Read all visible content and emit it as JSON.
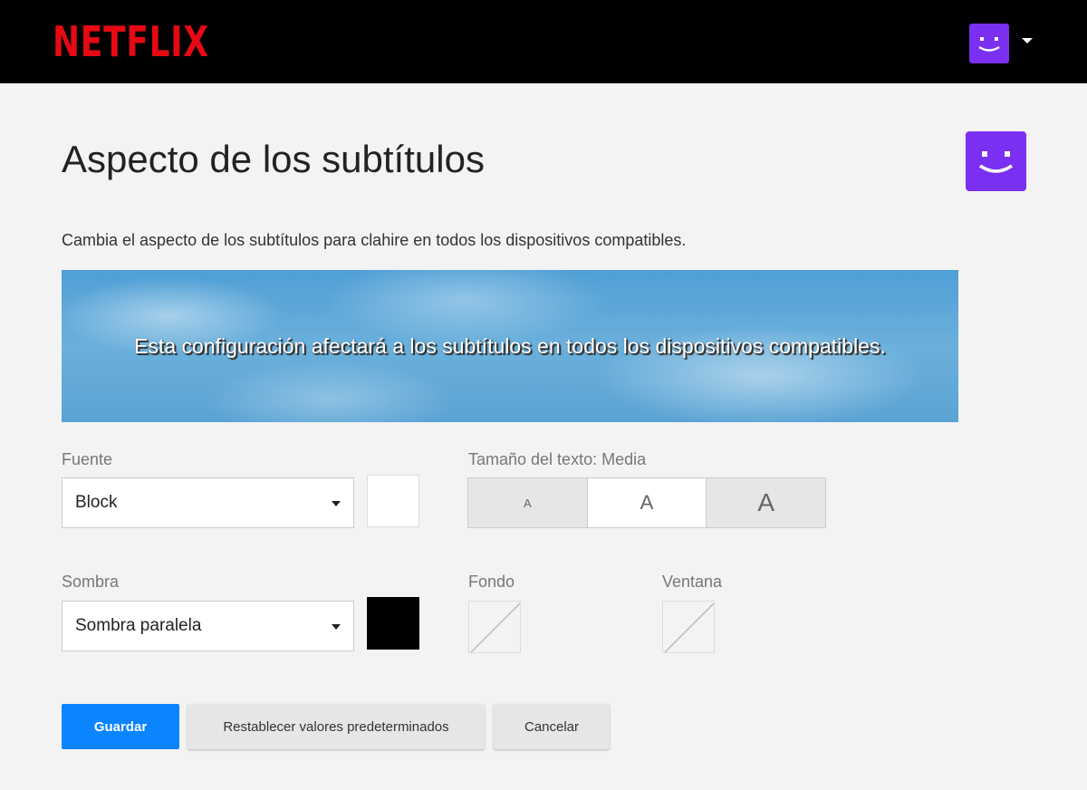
{
  "header": {
    "logo": "NETFLIX",
    "profile_icon": "smiley-profile-icon",
    "menu_icon": "caret-down-icon"
  },
  "page": {
    "title": "Aspecto de los subtítulos",
    "description": "Cambia el aspecto de los subtítulos para clahire en todos los dispositivos compatibles.",
    "preview_text": "Esta configuración afectará a los subtítulos en todos los dispositivos compatibles."
  },
  "font": {
    "label": "Fuente",
    "value": "Block",
    "color": "#ffffff"
  },
  "text_size": {
    "label": "Tamaño del texto: Media",
    "options": [
      "A",
      "A",
      "A"
    ],
    "selected_index": 1
  },
  "shadow": {
    "label": "Sombra",
    "value": "Sombra paralela",
    "color": "#000000"
  },
  "background": {
    "label": "Fondo"
  },
  "window": {
    "label": "Ventana"
  },
  "actions": {
    "save": "Guardar",
    "reset": "Restablecer valores predeterminados",
    "cancel": "Cancelar"
  },
  "colors": {
    "brand_red": "#e50914",
    "profile_purple": "#7b2ff0",
    "primary_blue": "#0a84ff"
  }
}
